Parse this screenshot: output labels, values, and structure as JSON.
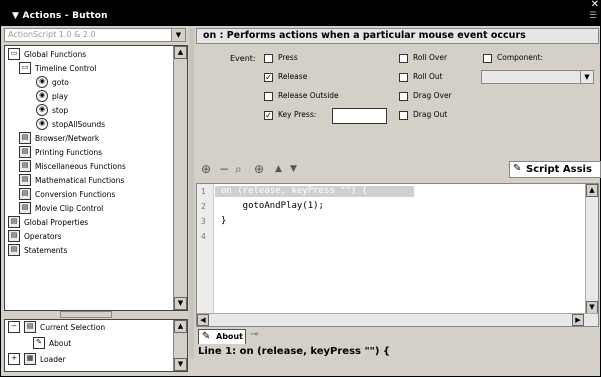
{
  "window": {
    "close_glyph": "✕",
    "panel_title": "▼ Actions - Button",
    "menu_glyph": "☰"
  },
  "toolbox": {
    "version_select": "ActionScript 1.0 & 2.0",
    "items": [
      {
        "label": "Global Functions",
        "icon": "book-open-icon",
        "glyph": "▭"
      },
      {
        "label": "Timeline Control",
        "icon": "book-open-icon",
        "glyph": "▭"
      },
      {
        "label": "goto",
        "icon": "circle-arrow-icon",
        "glyph": "◉"
      },
      {
        "label": "play",
        "icon": "circle-arrow-icon",
        "glyph": "◉"
      },
      {
        "label": "stop",
        "icon": "circle-arrow-icon",
        "glyph": "◉"
      },
      {
        "label": "stopAllSounds",
        "icon": "circle-arrow-icon",
        "glyph": "◉"
      },
      {
        "label": "Browser/Network",
        "icon": "book-closed-icon",
        "glyph": "▤"
      },
      {
        "label": "Printing Functions",
        "icon": "book-closed-icon",
        "glyph": "▤"
      },
      {
        "label": "Miscellaneous Functions",
        "icon": "book-closed-icon",
        "glyph": "▤"
      },
      {
        "label": "Mathematical Functions",
        "icon": "book-closed-icon",
        "glyph": "▤"
      },
      {
        "label": "Conversion Functions",
        "icon": "book-closed-icon",
        "glyph": "▤"
      },
      {
        "label": "Movie Clip Control",
        "icon": "book-closed-icon",
        "glyph": "▤"
      },
      {
        "label": "Global Properties",
        "icon": "book-closed-icon",
        "glyph": "▤"
      },
      {
        "label": "Operators",
        "icon": "book-closed-icon",
        "glyph": "▤"
      },
      {
        "label": "Statements",
        "icon": "book-closed-icon",
        "glyph": "▤"
      }
    ],
    "script_nav": [
      {
        "label": "Current Selection",
        "glyph": "▤"
      },
      {
        "label": "About",
        "glyph": "✎"
      },
      {
        "label": "Loader",
        "glyph": "▦"
      }
    ]
  },
  "hint_bar": {
    "text": "on : Performs actions when a particular mouse event occurs"
  },
  "params": {
    "event_label": "Event:",
    "press": "Press",
    "release": "Release",
    "release_outside": "Release Outside",
    "key_press": "Key Press:",
    "roll_over": "Roll Over",
    "roll_out": "Roll Out",
    "drag_over": "Drag Over",
    "drag_out": "Drag Out",
    "component": "Component:",
    "checked_glyph": "✓"
  },
  "toolbar": {
    "add_glyph": "⊕",
    "remove_glyph": "−",
    "find_glyph": "⌕",
    "target_glyph": "⊕",
    "up_glyph": "▲",
    "down_glyph": "▼",
    "script_assist_label": "Script Assis",
    "pencil_glyph": "✎",
    "help_glyph": "?"
  },
  "editor": {
    "lines": [
      {
        "num": "1",
        "code": "on (release, keyPress \"\") {"
      },
      {
        "num": "2",
        "code": "    gotoAndPlay(1);"
      },
      {
        "num": "3",
        "code": "}"
      },
      {
        "num": "4",
        "code": ""
      }
    ]
  },
  "tab": {
    "label": "About",
    "pin_glyph": "⊸"
  },
  "status": {
    "text": "Line 1: on (release, keyPress \"\") {"
  }
}
